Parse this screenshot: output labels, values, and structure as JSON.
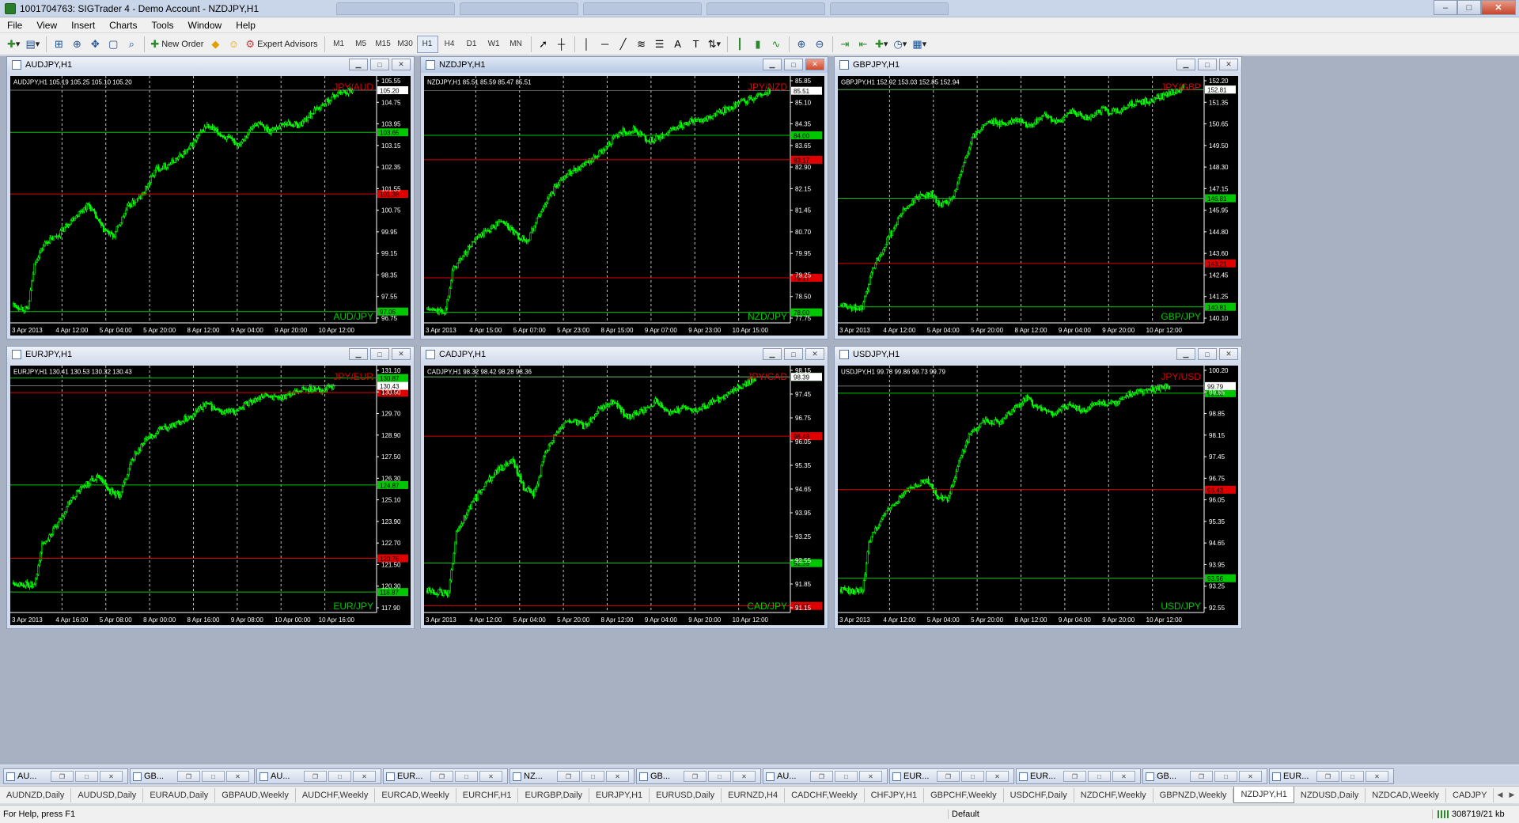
{
  "window": {
    "title": "1001704763: SIGTrader 4 - Demo Account - NZDJPY,H1",
    "controls": [
      "–",
      "□",
      "✕"
    ]
  },
  "menu": [
    "File",
    "View",
    "Insert",
    "Charts",
    "Tools",
    "Window",
    "Help"
  ],
  "toolbar": {
    "new_order_label": "New Order",
    "expert_advisors_label": "Expert Advisors",
    "timeframes": [
      "M1",
      "M5",
      "M15",
      "M30",
      "H1",
      "H4",
      "D1",
      "W1",
      "MN"
    ],
    "active_timeframe": "H1"
  },
  "colors": {
    "chart_bg": "#000000",
    "candle": "#00ff00",
    "green_line": "#00c800",
    "red_line": "#e00000",
    "grid": "#c0c0c0",
    "axis_text": "#ffffff",
    "label_green_bg": "#00c800",
    "label_red_bg": "#e00000"
  },
  "charts": [
    {
      "id": "audjpy",
      "window_title": "AUDJPY,H1",
      "info": "AUDJPY,H1  105.19 105.25 105.10 105.20",
      "top_label": "JPY/AUD",
      "bottom_label": "AUD/JPY",
      "active": false,
      "price_ticks": [
        "105.55",
        "104.75",
        "103.95",
        "103.15",
        "102.35",
        "101.55",
        "100.75",
        "99.95",
        "99.15",
        "98.35",
        "97.55",
        "96.75"
      ],
      "time_ticks": [
        "3 Apr 2013",
        "4 Apr 12:00",
        "5 Apr 04:00",
        "5 Apr 20:00",
        "8 Apr 12:00",
        "9 Apr 04:00",
        "9 Apr 20:00",
        "10 Apr 12:00"
      ],
      "current_price": "105.20",
      "ymin": 96.75,
      "ymax": 105.55,
      "levels": [
        {
          "price": 103.65,
          "color": "green",
          "label": "103.65"
        },
        {
          "price": 101.38,
          "color": "red",
          "label": "101.38"
        },
        {
          "price": 97.05,
          "color": "green",
          "label": "97.05"
        }
      ],
      "trend": [
        [
          0,
          97.3
        ],
        [
          0.04,
          97.1
        ],
        [
          0.06,
          98.9
        ],
        [
          0.09,
          99.6
        ],
        [
          0.12,
          99.8
        ],
        [
          0.16,
          100.4
        ],
        [
          0.21,
          101.0
        ],
        [
          0.25,
          100.1
        ],
        [
          0.28,
          99.8
        ],
        [
          0.32,
          100.9
        ],
        [
          0.36,
          101.3
        ],
        [
          0.4,
          102.3
        ],
        [
          0.44,
          102.5
        ],
        [
          0.49,
          103.0
        ],
        [
          0.54,
          103.9
        ],
        [
          0.59,
          103.5
        ],
        [
          0.63,
          103.2
        ],
        [
          0.68,
          104.0
        ],
        [
          0.72,
          103.7
        ],
        [
          0.76,
          104.0
        ],
        [
          0.8,
          103.9
        ],
        [
          0.84,
          104.4
        ],
        [
          0.87,
          104.7
        ],
        [
          0.91,
          105.1
        ],
        [
          0.95,
          105.2
        ]
      ]
    },
    {
      "id": "nzdjpy",
      "window_title": "NZDJPY,H1",
      "info": "NZDJPY,H1  85.51 85.59 85.47 85.51",
      "top_label": "JPY/NZD",
      "bottom_label": "NZD/JPY",
      "active": true,
      "price_ticks": [
        "85.85",
        "85.10",
        "84.35",
        "83.65",
        "82.90",
        "82.15",
        "81.45",
        "80.70",
        "79.95",
        "79.25",
        "78.50",
        "77.75"
      ],
      "time_ticks": [
        "3 Apr 2013",
        "4 Apr 15:00",
        "5 Apr 07:00",
        "5 Apr 23:00",
        "8 Apr 15:00",
        "9 Apr 07:00",
        "9 Apr 23:00",
        "10 Apr 15:00"
      ],
      "current_price": "85.51",
      "ymin": 77.75,
      "ymax": 85.85,
      "levels": [
        {
          "price": 84.0,
          "color": "green",
          "label": "84.00"
        },
        {
          "price": 83.17,
          "color": "red",
          "label": "83.17"
        },
        {
          "price": 79.17,
          "color": "red",
          "label": "79.17"
        },
        {
          "price": 78.0,
          "color": "green",
          "label": "78.00"
        }
      ],
      "trend": [
        [
          0,
          78.1
        ],
        [
          0.05,
          78.0
        ],
        [
          0.07,
          79.4
        ],
        [
          0.1,
          79.9
        ],
        [
          0.13,
          80.4
        ],
        [
          0.17,
          80.8
        ],
        [
          0.21,
          81.1
        ],
        [
          0.25,
          80.6
        ],
        [
          0.28,
          80.4
        ],
        [
          0.31,
          81.2
        ],
        [
          0.34,
          81.9
        ],
        [
          0.38,
          82.6
        ],
        [
          0.42,
          82.9
        ],
        [
          0.46,
          83.1
        ],
        [
          0.5,
          83.6
        ],
        [
          0.54,
          84.1
        ],
        [
          0.58,
          84.2
        ],
        [
          0.62,
          83.8
        ],
        [
          0.66,
          84.0
        ],
        [
          0.7,
          84.3
        ],
        [
          0.74,
          84.5
        ],
        [
          0.79,
          84.6
        ],
        [
          0.84,
          84.9
        ],
        [
          0.9,
          85.2
        ],
        [
          0.96,
          85.5
        ]
      ]
    },
    {
      "id": "gbpjpy",
      "window_title": "GBPJPY,H1",
      "info": "GBPJPY,H1  152.92 153.03 152.85 152.94",
      "top_label": "JPY/GBP",
      "bottom_label": "GBP/JPY",
      "active": false,
      "price_ticks": [
        "152.20",
        "151.35",
        "150.65",
        "149.50",
        "148.30",
        "147.15",
        "145.95",
        "144.80",
        "143.60",
        "142.45",
        "141.25",
        "140.10"
      ],
      "time_ticks": [
        "3 Apr 2013",
        "4 Apr 12:00",
        "5 Apr 04:00",
        "5 Apr 20:00",
        "8 Apr 12:00",
        "9 Apr 04:00",
        "9 Apr 20:00",
        "10 Apr 12:00"
      ],
      "current_price": "152.81",
      "ymin": 140.1,
      "ymax": 153.3,
      "levels": [
        {
          "price": 152.81,
          "color": "green",
          "label": "152.81"
        },
        {
          "price": 146.81,
          "color": "green",
          "label": "146.81"
        },
        {
          "price": 143.21,
          "color": "red",
          "label": "143.21"
        },
        {
          "price": 140.81,
          "color": "green",
          "label": "140.81"
        }
      ],
      "trend": [
        [
          0,
          140.9
        ],
        [
          0.06,
          140.7
        ],
        [
          0.09,
          143.0
        ],
        [
          0.13,
          144.5
        ],
        [
          0.17,
          146.0
        ],
        [
          0.21,
          146.8
        ],
        [
          0.25,
          147.1
        ],
        [
          0.28,
          146.4
        ],
        [
          0.31,
          146.7
        ],
        [
          0.34,
          148.5
        ],
        [
          0.37,
          150.2
        ],
        [
          0.41,
          151.1
        ],
        [
          0.45,
          150.9
        ],
        [
          0.49,
          151.2
        ],
        [
          0.53,
          150.8
        ],
        [
          0.57,
          151.4
        ],
        [
          0.61,
          151.0
        ],
        [
          0.65,
          151.6
        ],
        [
          0.69,
          151.2
        ],
        [
          0.73,
          151.7
        ],
        [
          0.77,
          151.6
        ],
        [
          0.81,
          152.0
        ],
        [
          0.86,
          152.2
        ],
        [
          0.91,
          152.5
        ],
        [
          0.96,
          152.9
        ]
      ]
    },
    {
      "id": "eurjpy",
      "window_title": "EURJPY,H1",
      "info": "EURJPY,H1  130.41 130.53 130.32 130.43",
      "top_label": "JPY/EUR",
      "bottom_label": "EUR/JPY",
      "active": false,
      "price_ticks": [
        "131.10",
        "130.50",
        "129.70",
        "128.90",
        "127.50",
        "126.30",
        "125.10",
        "123.90",
        "122.70",
        "121.50",
        "120.30",
        "117.90"
      ],
      "time_ticks": [
        "3 Apr 2013",
        "4 Apr 16:00",
        "5 Apr 08:00",
        "8 Apr 00:00",
        "8 Apr 16:00",
        "9 Apr 08:00",
        "10 Apr 00:00",
        "10 Apr 16:00"
      ],
      "current_price": "130.43",
      "ymin": 117.9,
      "ymax": 131.3,
      "levels": [
        {
          "price": 130.87,
          "color": "green",
          "label": "130.87"
        },
        {
          "price": 130.05,
          "color": "red",
          "label": "130.05"
        },
        {
          "price": 124.87,
          "color": "green",
          "label": "124.87"
        },
        {
          "price": 120.76,
          "color": "red",
          "label": "120.76"
        },
        {
          "price": 118.87,
          "color": "green",
          "label": "118.87"
        }
      ],
      "trend": [
        [
          0,
          119.4
        ],
        [
          0.06,
          119.2
        ],
        [
          0.08,
          121.5
        ],
        [
          0.12,
          122.5
        ],
        [
          0.16,
          124.0
        ],
        [
          0.2,
          124.9
        ],
        [
          0.24,
          125.4
        ],
        [
          0.27,
          124.5
        ],
        [
          0.3,
          124.3
        ],
        [
          0.33,
          126.2
        ],
        [
          0.37,
          127.4
        ],
        [
          0.41,
          128.0
        ],
        [
          0.45,
          128.2
        ],
        [
          0.5,
          128.8
        ],
        [
          0.54,
          129.4
        ],
        [
          0.58,
          128.9
        ],
        [
          0.62,
          129.0
        ],
        [
          0.66,
          129.5
        ],
        [
          0.7,
          129.9
        ],
        [
          0.74,
          129.7
        ],
        [
          0.78,
          130.0
        ],
        [
          0.82,
          130.3
        ],
        [
          0.86,
          130.2
        ],
        [
          0.9,
          130.4
        ]
      ]
    },
    {
      "id": "cadjpy",
      "window_title": "CADJPY,H1",
      "info": "CADJPY,H1  98.32 98.42 98.28 98.36",
      "top_label": "JPY/CAD",
      "bottom_label": "CAD/JPY",
      "active": false,
      "price_ticks": [
        "98.15",
        "97.45",
        "96.75",
        "96.05",
        "95.35",
        "94.65",
        "93.95",
        "93.25",
        "92.55",
        "91.85",
        "91.15"
      ],
      "time_ticks": [
        "3 Apr 2013",
        "4 Apr 12:00",
        "5 Apr 04:00",
        "5 Apr 20:00",
        "8 Apr 12:00",
        "9 Apr 04:00",
        "9 Apr 20:00",
        "10 Apr 12:00"
      ],
      "current_price": "98.39",
      "ymin": 90.9,
      "ymax": 98.6,
      "levels": [
        {
          "price": 98.39,
          "color": "green",
          "label": "98.39"
        },
        {
          "price": 96.48,
          "color": "red",
          "label": "96.48"
        },
        {
          "price": 92.39,
          "color": "green",
          "label": "92.39"
        },
        {
          "price": 91.01,
          "color": "red",
          "label": "91.01"
        }
      ],
      "trend": [
        [
          0,
          91.5
        ],
        [
          0.06,
          91.4
        ],
        [
          0.08,
          93.3
        ],
        [
          0.12,
          94.2
        ],
        [
          0.16,
          94.9
        ],
        [
          0.2,
          95.4
        ],
        [
          0.24,
          95.7
        ],
        [
          0.27,
          94.8
        ],
        [
          0.3,
          94.6
        ],
        [
          0.33,
          95.9
        ],
        [
          0.36,
          96.6
        ],
        [
          0.4,
          97.0
        ],
        [
          0.44,
          96.8
        ],
        [
          0.48,
          97.3
        ],
        [
          0.52,
          97.6
        ],
        [
          0.56,
          97.1
        ],
        [
          0.6,
          97.3
        ],
        [
          0.64,
          97.6
        ],
        [
          0.68,
          97.2
        ],
        [
          0.72,
          97.4
        ],
        [
          0.76,
          97.3
        ],
        [
          0.8,
          97.6
        ],
        [
          0.84,
          97.8
        ],
        [
          0.88,
          98.1
        ],
        [
          0.92,
          98.3
        ]
      ]
    },
    {
      "id": "usdjpy",
      "window_title": "USDJPY,H1",
      "info": "USDJPY,H1  99.78 99.86 99.73 99.79",
      "top_label": "JPY/USD",
      "bottom_label": "USD/JPY",
      "active": false,
      "price_ticks": [
        "100.20",
        "99.55",
        "98.85",
        "98.15",
        "97.45",
        "96.75",
        "96.05",
        "95.35",
        "94.65",
        "93.95",
        "93.25",
        "92.55"
      ],
      "time_ticks": [
        "3 Apr 2013",
        "4 Apr 12:00",
        "5 Apr 04:00",
        "5 Apr 20:00",
        "8 Apr 12:00",
        "9 Apr 04:00",
        "9 Apr 20:00",
        "10 Apr 12:00"
      ],
      "current_price": "99.79",
      "ymin": 92.55,
      "ymax": 100.3,
      "levels": [
        {
          "price": 99.56,
          "color": "green",
          "label": "99.56"
        },
        {
          "price": 96.43,
          "color": "red",
          "label": "96.43"
        },
        {
          "price": 93.56,
          "color": "green",
          "label": "93.56"
        }
      ],
      "trend": [
        [
          0,
          93.2
        ],
        [
          0.06,
          93.1
        ],
        [
          0.08,
          94.8
        ],
        [
          0.12,
          95.6
        ],
        [
          0.16,
          96.1
        ],
        [
          0.2,
          96.5
        ],
        [
          0.24,
          96.8
        ],
        [
          0.27,
          96.2
        ],
        [
          0.3,
          96.1
        ],
        [
          0.33,
          97.3
        ],
        [
          0.36,
          98.2
        ],
        [
          0.4,
          98.7
        ],
        [
          0.44,
          98.6
        ],
        [
          0.48,
          99.0
        ],
        [
          0.52,
          99.4
        ],
        [
          0.56,
          99.0
        ],
        [
          0.6,
          98.9
        ],
        [
          0.64,
          99.2
        ],
        [
          0.68,
          99.0
        ],
        [
          0.72,
          99.3
        ],
        [
          0.76,
          99.2
        ],
        [
          0.8,
          99.5
        ],
        [
          0.84,
          99.6
        ],
        [
          0.88,
          99.7
        ],
        [
          0.92,
          99.8
        ]
      ]
    }
  ],
  "window_tabs": [
    "AU...",
    "GB...",
    "AU...",
    "EUR...",
    "NZ...",
    "GB...",
    "AU...",
    "EUR...",
    "EUR...",
    "GB...",
    "EUR..."
  ],
  "symbol_tabs": [
    "AUDNZD,Daily",
    "AUDUSD,Daily",
    "EURAUD,Daily",
    "GBPAUD,Weekly",
    "AUDCHF,Weekly",
    "EURCAD,Weekly",
    "EURCHF,H1",
    "EURGBP,Daily",
    "EURJPY,H1",
    "EURUSD,Daily",
    "EURNZD,H4",
    "CADCHF,Weekly",
    "CHFJPY,H1",
    "GBPCHF,Weekly",
    "USDCHF,Daily",
    "NZDCHF,Weekly",
    "GBPNZD,Weekly",
    "NZDJPY,H1",
    "NZDUSD,Daily",
    "NZDCAD,Weekly",
    "CADJPY"
  ],
  "active_symbol_tab": "NZDJPY,H1",
  "status": {
    "help": "For Help, press F1",
    "profile": "Default",
    "traffic": "308719/21 kb"
  }
}
